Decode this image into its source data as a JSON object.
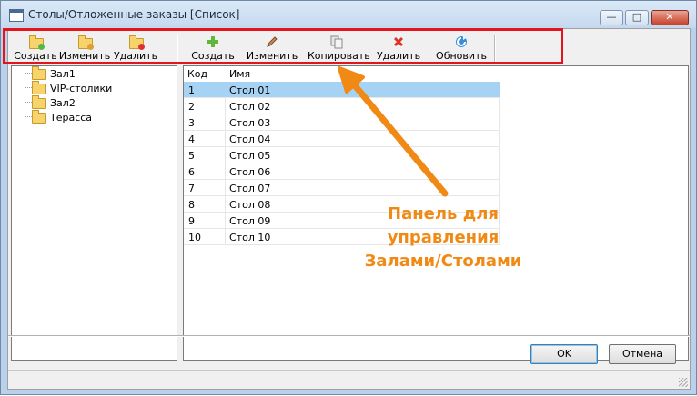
{
  "window": {
    "title": "Столы/Отложенные заказы [Список]",
    "controls": {
      "minimize": "—",
      "maximize": "□",
      "close": "✕"
    }
  },
  "toolbar": {
    "halls": [
      {
        "label": "Создать",
        "icon": "folder-add-icon",
        "badge": "#54b848"
      },
      {
        "label": "Изменить",
        "icon": "folder-edit-icon",
        "badge": "#e0a030"
      },
      {
        "label": "Удалить",
        "icon": "folder-delete-icon",
        "badge": "#e03030"
      }
    ],
    "tables": [
      {
        "label": "Создать",
        "icon": "plus-icon"
      },
      {
        "label": "Изменить",
        "icon": "pencil-icon"
      },
      {
        "label": "Копировать",
        "icon": "copy-icon"
      },
      {
        "label": "Удалить",
        "icon": "delete-x-icon"
      },
      {
        "label": "Обновить",
        "icon": "refresh-icon"
      }
    ]
  },
  "tree": {
    "items": [
      {
        "label": "Зал1",
        "selected": true
      },
      {
        "label": "VIP-столики"
      },
      {
        "label": "Зал2"
      },
      {
        "label": "Терасса"
      }
    ]
  },
  "grid": {
    "columns": [
      "Код",
      "Имя"
    ],
    "rows": [
      [
        "1",
        "Стол 01"
      ],
      [
        "2",
        "Стол 02"
      ],
      [
        "3",
        "Стол 03"
      ],
      [
        "4",
        "Стол 04"
      ],
      [
        "5",
        "Стол 05"
      ],
      [
        "6",
        "Стол 06"
      ],
      [
        "7",
        "Стол 07"
      ],
      [
        "8",
        "Стол 08"
      ],
      [
        "9",
        "Стол 09"
      ],
      [
        "10",
        "Стол 10"
      ]
    ]
  },
  "buttons": {
    "ok": "OK",
    "cancel": "Отмена"
  },
  "annotation": {
    "line1": "Панель для управления",
    "line2": "Залами/Столами",
    "color": "#f08a14"
  },
  "colors": {
    "highlight_box": "#e3141b",
    "selection": "#a6d2f4"
  }
}
